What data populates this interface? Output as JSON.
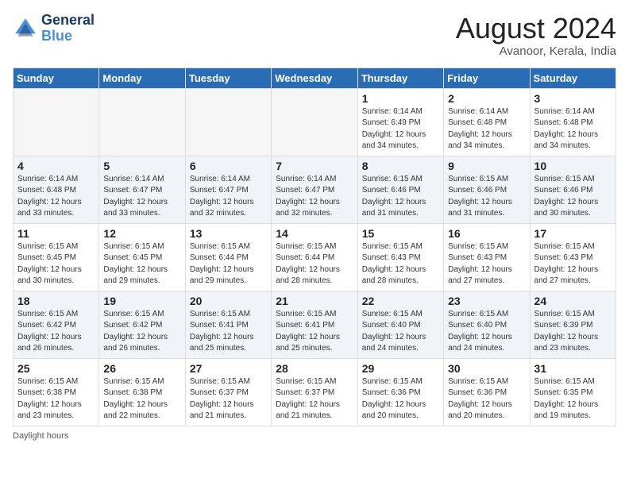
{
  "header": {
    "logo_line1": "General",
    "logo_line2": "Blue",
    "month_title": "August 2024",
    "location": "Avanoor, Kerala, India"
  },
  "calendar": {
    "days_of_week": [
      "Sunday",
      "Monday",
      "Tuesday",
      "Wednesday",
      "Thursday",
      "Friday",
      "Saturday"
    ],
    "weeks": [
      [
        {
          "day": "",
          "info": ""
        },
        {
          "day": "",
          "info": ""
        },
        {
          "day": "",
          "info": ""
        },
        {
          "day": "",
          "info": ""
        },
        {
          "day": "1",
          "info": "Sunrise: 6:14 AM\nSunset: 6:49 PM\nDaylight: 12 hours\nand 34 minutes."
        },
        {
          "day": "2",
          "info": "Sunrise: 6:14 AM\nSunset: 6:48 PM\nDaylight: 12 hours\nand 34 minutes."
        },
        {
          "day": "3",
          "info": "Sunrise: 6:14 AM\nSunset: 6:48 PM\nDaylight: 12 hours\nand 34 minutes."
        }
      ],
      [
        {
          "day": "4",
          "info": "Sunrise: 6:14 AM\nSunset: 6:48 PM\nDaylight: 12 hours\nand 33 minutes."
        },
        {
          "day": "5",
          "info": "Sunrise: 6:14 AM\nSunset: 6:47 PM\nDaylight: 12 hours\nand 33 minutes."
        },
        {
          "day": "6",
          "info": "Sunrise: 6:14 AM\nSunset: 6:47 PM\nDaylight: 12 hours\nand 32 minutes."
        },
        {
          "day": "7",
          "info": "Sunrise: 6:14 AM\nSunset: 6:47 PM\nDaylight: 12 hours\nand 32 minutes."
        },
        {
          "day": "8",
          "info": "Sunrise: 6:15 AM\nSunset: 6:46 PM\nDaylight: 12 hours\nand 31 minutes."
        },
        {
          "day": "9",
          "info": "Sunrise: 6:15 AM\nSunset: 6:46 PM\nDaylight: 12 hours\nand 31 minutes."
        },
        {
          "day": "10",
          "info": "Sunrise: 6:15 AM\nSunset: 6:46 PM\nDaylight: 12 hours\nand 30 minutes."
        }
      ],
      [
        {
          "day": "11",
          "info": "Sunrise: 6:15 AM\nSunset: 6:45 PM\nDaylight: 12 hours\nand 30 minutes."
        },
        {
          "day": "12",
          "info": "Sunrise: 6:15 AM\nSunset: 6:45 PM\nDaylight: 12 hours\nand 29 minutes."
        },
        {
          "day": "13",
          "info": "Sunrise: 6:15 AM\nSunset: 6:44 PM\nDaylight: 12 hours\nand 29 minutes."
        },
        {
          "day": "14",
          "info": "Sunrise: 6:15 AM\nSunset: 6:44 PM\nDaylight: 12 hours\nand 28 minutes."
        },
        {
          "day": "15",
          "info": "Sunrise: 6:15 AM\nSunset: 6:43 PM\nDaylight: 12 hours\nand 28 minutes."
        },
        {
          "day": "16",
          "info": "Sunrise: 6:15 AM\nSunset: 6:43 PM\nDaylight: 12 hours\nand 27 minutes."
        },
        {
          "day": "17",
          "info": "Sunrise: 6:15 AM\nSunset: 6:43 PM\nDaylight: 12 hours\nand 27 minutes."
        }
      ],
      [
        {
          "day": "18",
          "info": "Sunrise: 6:15 AM\nSunset: 6:42 PM\nDaylight: 12 hours\nand 26 minutes."
        },
        {
          "day": "19",
          "info": "Sunrise: 6:15 AM\nSunset: 6:42 PM\nDaylight: 12 hours\nand 26 minutes."
        },
        {
          "day": "20",
          "info": "Sunrise: 6:15 AM\nSunset: 6:41 PM\nDaylight: 12 hours\nand 25 minutes."
        },
        {
          "day": "21",
          "info": "Sunrise: 6:15 AM\nSunset: 6:41 PM\nDaylight: 12 hours\nand 25 minutes."
        },
        {
          "day": "22",
          "info": "Sunrise: 6:15 AM\nSunset: 6:40 PM\nDaylight: 12 hours\nand 24 minutes."
        },
        {
          "day": "23",
          "info": "Sunrise: 6:15 AM\nSunset: 6:40 PM\nDaylight: 12 hours\nand 24 minutes."
        },
        {
          "day": "24",
          "info": "Sunrise: 6:15 AM\nSunset: 6:39 PM\nDaylight: 12 hours\nand 23 minutes."
        }
      ],
      [
        {
          "day": "25",
          "info": "Sunrise: 6:15 AM\nSunset: 6:38 PM\nDaylight: 12 hours\nand 23 minutes."
        },
        {
          "day": "26",
          "info": "Sunrise: 6:15 AM\nSunset: 6:38 PM\nDaylight: 12 hours\nand 22 minutes."
        },
        {
          "day": "27",
          "info": "Sunrise: 6:15 AM\nSunset: 6:37 PM\nDaylight: 12 hours\nand 21 minutes."
        },
        {
          "day": "28",
          "info": "Sunrise: 6:15 AM\nSunset: 6:37 PM\nDaylight: 12 hours\nand 21 minutes."
        },
        {
          "day": "29",
          "info": "Sunrise: 6:15 AM\nSunset: 6:36 PM\nDaylight: 12 hours\nand 20 minutes."
        },
        {
          "day": "30",
          "info": "Sunrise: 6:15 AM\nSunset: 6:36 PM\nDaylight: 12 hours\nand 20 minutes."
        },
        {
          "day": "31",
          "info": "Sunrise: 6:15 AM\nSunset: 6:35 PM\nDaylight: 12 hours\nand 19 minutes."
        }
      ]
    ]
  },
  "footer": {
    "daylight_label": "Daylight hours"
  }
}
